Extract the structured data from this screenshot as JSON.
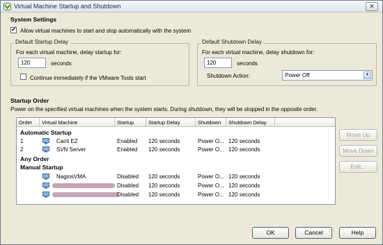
{
  "window": {
    "title": "Virtual Machine Startup and Shutdown",
    "close_label": "✕"
  },
  "system_settings": {
    "title": "System Settings",
    "allow_label": "Allow virtual machines to start and stop automatically with the system",
    "allow_checked": true
  },
  "startup_delay": {
    "group_label": "Default Startup Delay",
    "instruction": "For each virtual machine, delay startup for:",
    "value": "120",
    "unit": "seconds",
    "continue_label": "Continue immediately if the VMware Tools start",
    "continue_checked": false
  },
  "shutdown_delay": {
    "group_label": "Default Shutdown Delay",
    "instruction": "For each virtual machine, delay shutdown for:",
    "value": "120",
    "unit": "seconds",
    "action_label": "Shutdown Action:",
    "action_value": "Power Off"
  },
  "startup_order": {
    "title": "Startup Order",
    "description": "Power on the specified virtual machines when the system starts. During shutdown, they will be stopped in the opposite order.",
    "columns": [
      "Order",
      "Virtual Machine",
      "Startup",
      "Startup Delay",
      "Shutdown",
      "Shutdown Delay"
    ],
    "groups": {
      "automatic": "Automatic Startup",
      "any": "Any Order",
      "manual": "Manual Startup"
    },
    "rows": [
      {
        "order": "1",
        "vm": "Cacti EZ",
        "startup": "Enabled",
        "startup_delay": "120 seconds",
        "shutdown": "Power O...",
        "shutdown_delay": "120 seconds"
      },
      {
        "order": "2",
        "vm": "SVN Server",
        "startup": "Enabled",
        "startup_delay": "120 seconds",
        "shutdown": "Power O...",
        "shutdown_delay": "120 seconds"
      },
      {
        "order": "",
        "vm": "NagiosVMA",
        "startup": "Disabled",
        "startup_delay": "120 seconds",
        "shutdown": "Power O...",
        "shutdown_delay": "120 seconds"
      },
      {
        "order": "",
        "vm": "",
        "startup": "Disabled",
        "startup_delay": "120 seconds",
        "shutdown": "Power O...",
        "shutdown_delay": "120 seconds"
      },
      {
        "order": "",
        "vm": "",
        "startup": "Disabled",
        "startup_delay": "120 seconds",
        "shutdown": "Power O...",
        "shutdown_delay": "120 seconds"
      }
    ]
  },
  "side_buttons": {
    "move_up": "Move Up",
    "move_down": "Move Down",
    "edit": "Edit..."
  },
  "footer": {
    "ok": "OK",
    "cancel": "Cancel",
    "help": "Help"
  },
  "icons": {
    "title": "vm-gear-icon",
    "vm": "virtual-machine-icon",
    "checkbox": "check-icon",
    "dropdown": "chevron-down-icon"
  },
  "colors": {
    "background": "#ece9d8",
    "accent": "#4e5d78",
    "redaction": "#c6a6b6"
  }
}
